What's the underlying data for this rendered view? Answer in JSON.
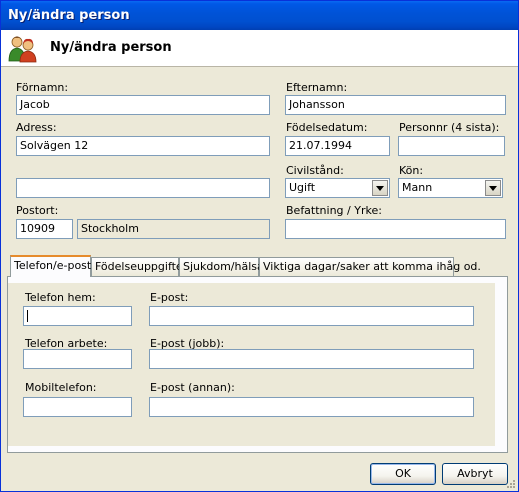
{
  "window": {
    "title": "Ny/ändra person"
  },
  "header": {
    "title": "Ny/ändra person",
    "icon": "people-icon"
  },
  "form": {
    "fornamn": {
      "label": "Förnamn:",
      "value": "Jacob"
    },
    "efternamn": {
      "label": "Efternamn:",
      "value": "Johansson"
    },
    "adress": {
      "label": "Adress:",
      "value": "Solvägen 12",
      "value2": ""
    },
    "fodelsedatum": {
      "label": "Födelsedatum:",
      "value": "21.07.1994"
    },
    "personnr": {
      "label": "Personnr (4 sista):",
      "value": ""
    },
    "civilstand": {
      "label": "Civilstånd:",
      "value": "Ugift"
    },
    "kon": {
      "label": "Kön:",
      "value": "Mann"
    },
    "postort": {
      "label": "Postort:",
      "zip": "10909",
      "city": "Stockholm"
    },
    "befattning": {
      "label": "Befattning / Yrke:",
      "value": ""
    }
  },
  "tabs": [
    {
      "label": "Telefon/e-post"
    },
    {
      "label": "Födelseuppgifter"
    },
    {
      "label": "Sjukdom/hälsa"
    },
    {
      "label": "Viktiga dagar/saker att komma ihåg od."
    }
  ],
  "contact": {
    "telefon_hem": {
      "label": "Telefon hem:",
      "value": ""
    },
    "telefon_arbete": {
      "label": "Telefon arbete:",
      "value": ""
    },
    "mobiltelefon": {
      "label": "Mobiltelefon:",
      "value": ""
    },
    "epost": {
      "label": "E-post:",
      "value": ""
    },
    "epost_jobb": {
      "label": "E-post (jobb):",
      "value": ""
    },
    "epost_annan": {
      "label": "E-post (annan):",
      "value": ""
    }
  },
  "buttons": {
    "ok": "OK",
    "cancel": "Avbryt"
  }
}
